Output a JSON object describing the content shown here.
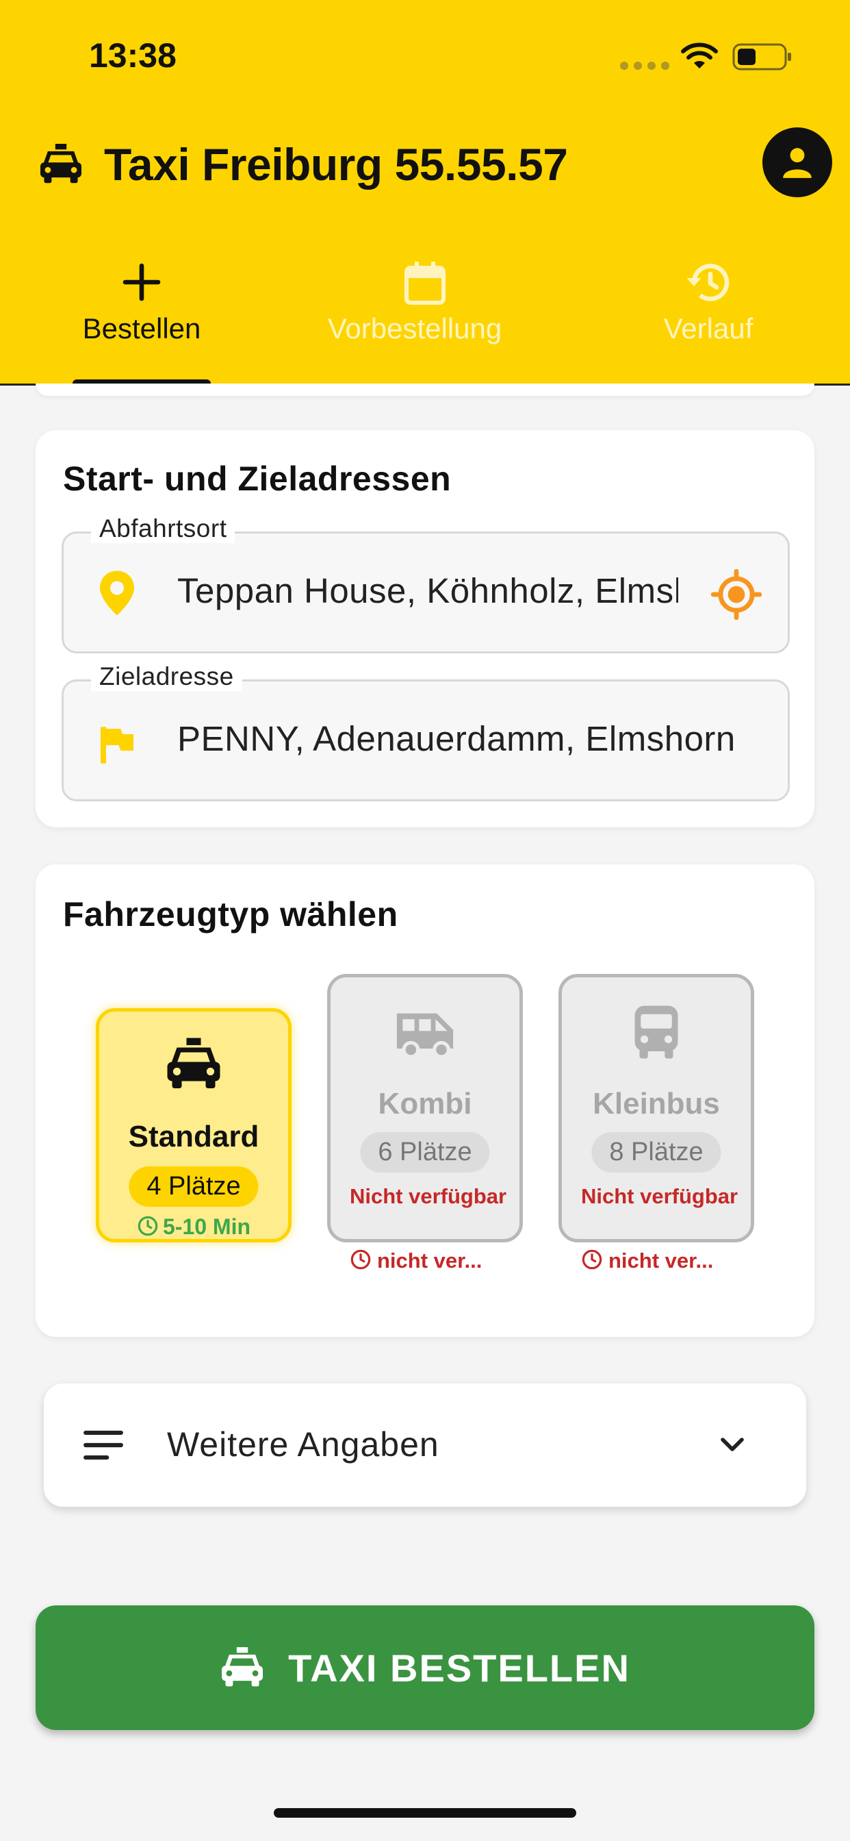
{
  "status_bar": {
    "time": "13:38"
  },
  "header": {
    "title": "Taxi Freiburg 55.55.57",
    "brand_color": "#FDD400",
    "icons": {
      "car": "taxi-icon",
      "avatar": "account-icon"
    }
  },
  "tabs": [
    {
      "label": "Bestellen",
      "icon": "plus-icon",
      "active": true
    },
    {
      "label": "Vorbestellung",
      "icon": "calendar-icon",
      "active": false
    },
    {
      "label": "Verlauf",
      "icon": "history-icon",
      "active": false
    }
  ],
  "addresses": {
    "title": "Start- und Zieladressen",
    "start": {
      "label": "Abfahrtsort",
      "value": "Teppan House, Köhnholz, Elmshorn"
    },
    "destination": {
      "label": "Zieladresse",
      "value": "PENNY, Adenauerdamm, Elmshorn"
    }
  },
  "vehicles": {
    "title": "Fahrzeugtyp wählen",
    "items": [
      {
        "name": "Standard",
        "seats": "4 Plätze",
        "eta": "5-10 Min",
        "available": true
      },
      {
        "name": "Kombi",
        "seats": "6 Plätze",
        "status": "Nicht verfügbar",
        "eta": "nicht ver...",
        "available": false
      },
      {
        "name": "Kleinbus",
        "seats": "8 Plätze",
        "status": "Nicht verfügbar",
        "eta": "nicht ver...",
        "available": false
      }
    ]
  },
  "more_info": {
    "label": "Weitere Angaben"
  },
  "order_button": {
    "label": "TAXI BESTELLEN",
    "color": "#3a9340"
  }
}
